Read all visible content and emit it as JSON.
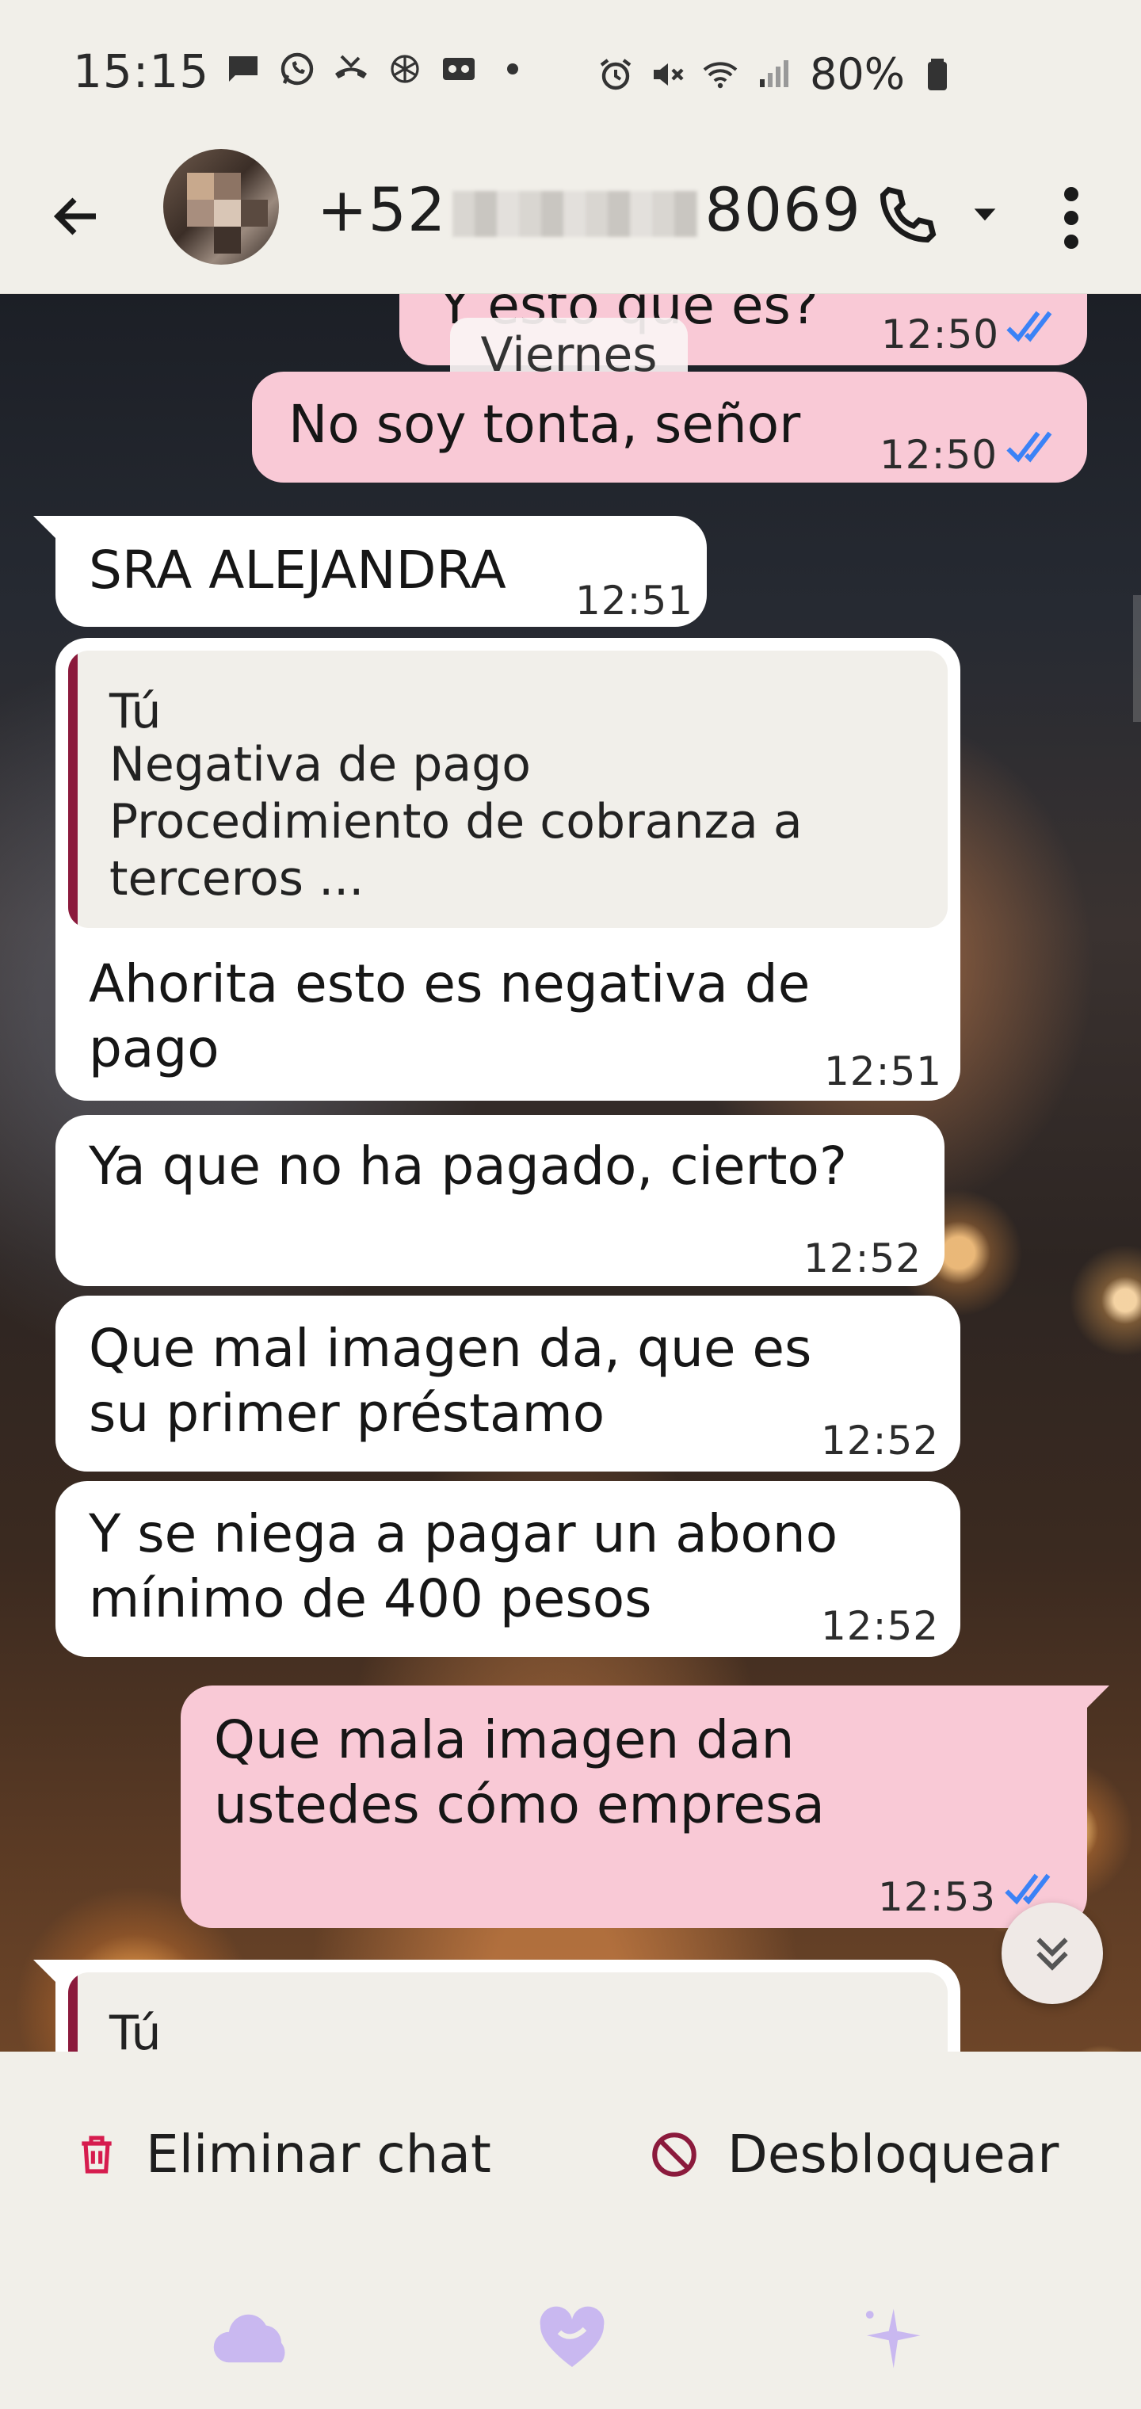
{
  "status_bar": {
    "time": "15:15",
    "battery_text": "80%",
    "left_icons": [
      "message-icon",
      "whatsapp-icon",
      "missed-call-icon",
      "openai-icon",
      "voicemail-icon",
      "dot-icon"
    ],
    "right_icons": [
      "alarm-icon",
      "mute-icon",
      "wifi-icon",
      "signal-icon",
      "battery-icon"
    ]
  },
  "header": {
    "contact_prefix": "+52",
    "contact_suffix": "8069"
  },
  "chat": {
    "date_chip": "Viernes",
    "messages": [
      {
        "dir": "out",
        "text": "Y esto qué es?",
        "time": "12:50"
      },
      {
        "dir": "out",
        "text": "No soy tonta, señor",
        "time": "12:50"
      },
      {
        "dir": "in",
        "text": "SRA ALEJANDRA",
        "time": "12:51"
      },
      {
        "dir": "in",
        "quote_author": "Tú",
        "quote_lines": [
          "Negativa de pago",
          "Procedimiento de cobranza a",
          "terceros ..."
        ],
        "lines": [
          "Ahorita esto es negativa de",
          "pago"
        ],
        "time": "12:51"
      },
      {
        "dir": "in",
        "text": "Ya que no ha pagado, cierto?",
        "time": "12:52"
      },
      {
        "dir": "in",
        "lines": [
          "Que mal imagen da, que es",
          "su primer préstamo"
        ],
        "time": "12:52"
      },
      {
        "dir": "in",
        "lines": [
          "Y se niega a pagar un abono",
          "mínimo de 400 pesos"
        ],
        "time": "12:52"
      },
      {
        "dir": "out",
        "lines": [
          "Que mala imagen dan",
          "ustedes cómo empresa"
        ],
        "time": "12:53"
      },
      {
        "dir": "in",
        "quote_author": "Tú"
      }
    ]
  },
  "blocked_bar": {
    "delete_label": "Eliminar chat",
    "unblock_label": "Desbloquear"
  },
  "nav_icons": [
    "cloud-icon",
    "heart-icon",
    "sparkle-icon"
  ],
  "colors": {
    "outgoing_bubble": "#f9c9d6",
    "incoming_bubble": "#ffffff",
    "quote_bar": "#8b1a3c",
    "read_ticks": "#3b82f6",
    "nav_icons": "#c9b8f0"
  }
}
